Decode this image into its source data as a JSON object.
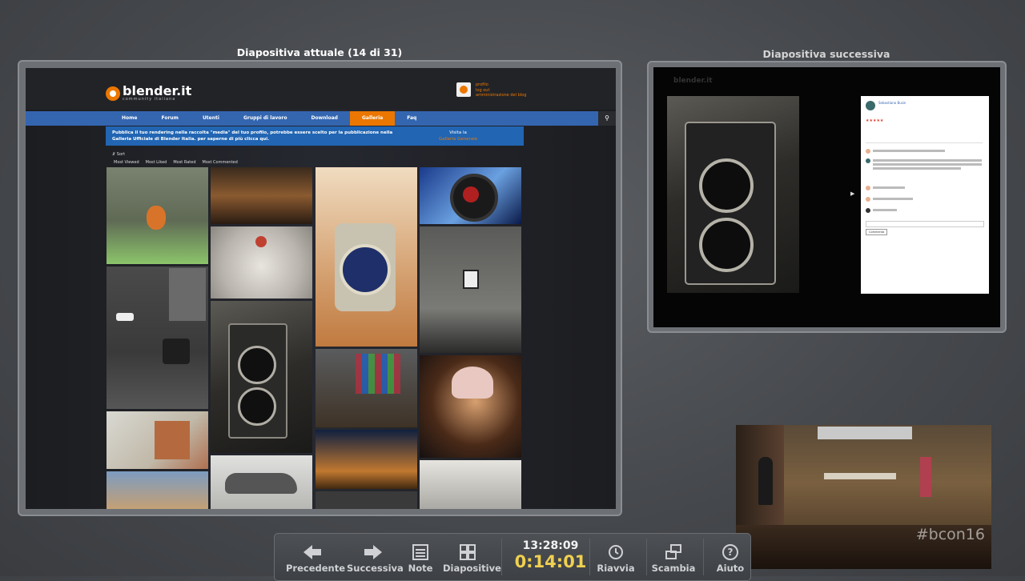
{
  "current_title": "Diapositiva attuale (14 di 31)",
  "next_title": "Diapositiva successiva",
  "slide": {
    "logo_text": "blender.it",
    "logo_sub": "community italiana",
    "user_links": [
      "profilo",
      "log out",
      "amministrazione del blog"
    ],
    "nav": [
      "Home",
      "Forum",
      "Utenti",
      "Gruppi di lavoro",
      "Download",
      "Galleria",
      "Faq"
    ],
    "nav_active": "Galleria",
    "info_text": "Pubblica il tuo rendering nella raccolta \"media\" del tuo profilo, potrebbe essere scelto per la pubblicazione nella Galleria Ufficiale di Blender Italia. per saperne di più clicca qui.",
    "info_visit": "Visita la",
    "info_link": "Galleria Generale",
    "sort_label": "Sort",
    "filters": [
      "Most Viewed",
      "Most Liked",
      "Most Rated",
      "Most Commented"
    ]
  },
  "next_slide": {
    "logo_text": "blender.it",
    "user_name": "Sebastiano Busin",
    "comment_button": "Commenta"
  },
  "toolbar": {
    "prev": "Precedente",
    "next": "Successiva",
    "notes": "Note",
    "slides": "Diapositive",
    "clock": "13:28:09",
    "elapsed": "0:14:01",
    "restart": "Riavvia",
    "swap": "Scambia",
    "help": "Aiuto"
  },
  "webcam_tag": "#bcon16",
  "colors": {
    "brand_orange": "#eb7700",
    "nav_blue": "#3466b0",
    "elapsed_yellow": "#f0d050"
  }
}
